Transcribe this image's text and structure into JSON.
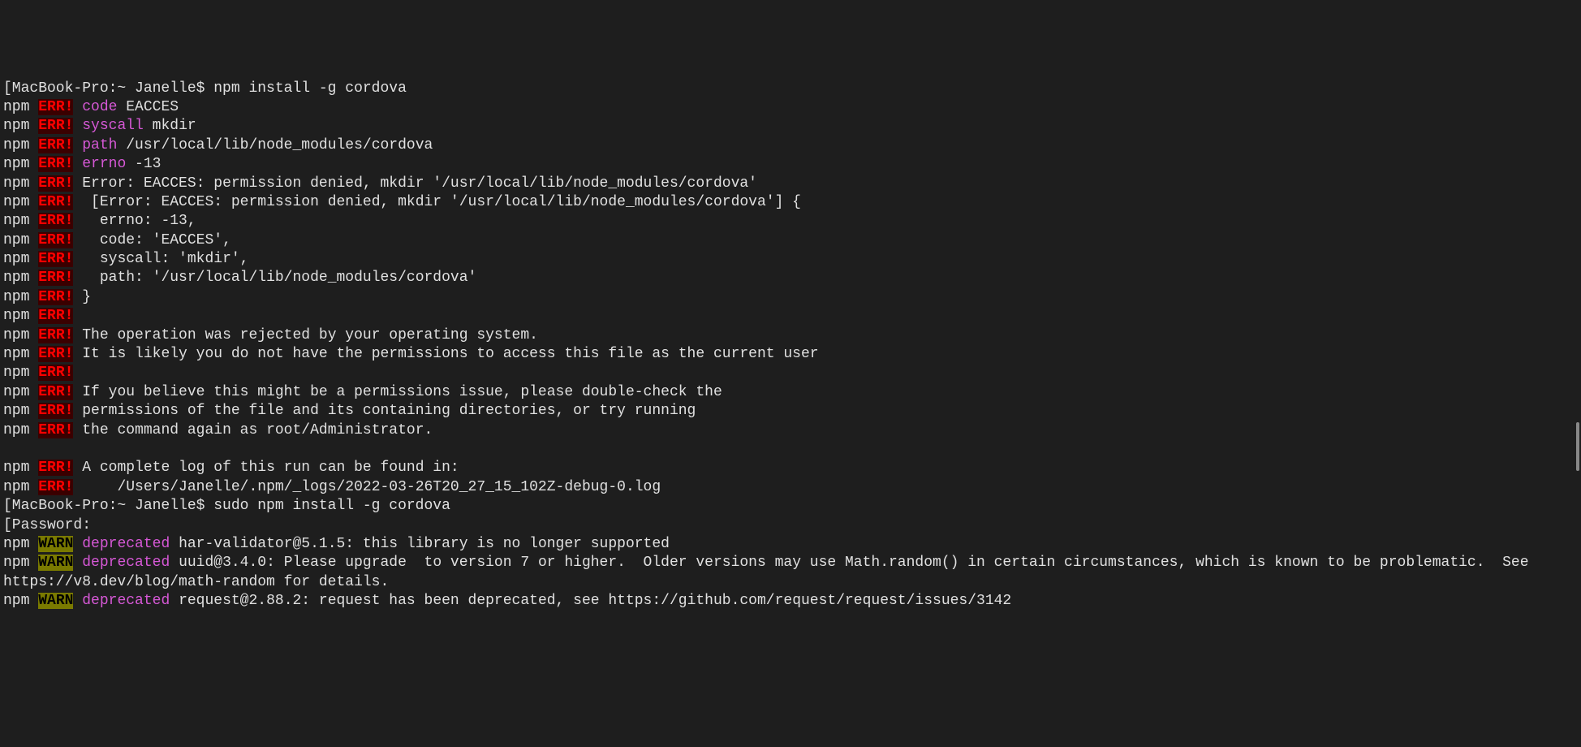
{
  "lines": [
    {
      "type": "prompt",
      "text": "[MacBook-Pro:~ Janelle$ npm install -g cordova"
    },
    {
      "type": "err",
      "prefix": "npm ",
      "tag": "ERR!",
      "key": " code",
      "msg": " EACCES"
    },
    {
      "type": "err",
      "prefix": "npm ",
      "tag": "ERR!",
      "key": " syscall",
      "msg": " mkdir"
    },
    {
      "type": "err",
      "prefix": "npm ",
      "tag": "ERR!",
      "key": " path",
      "msg": " /usr/local/lib/node_modules/cordova"
    },
    {
      "type": "err",
      "prefix": "npm ",
      "tag": "ERR!",
      "key": " errno",
      "msg": " -13"
    },
    {
      "type": "err",
      "prefix": "npm ",
      "tag": "ERR!",
      "msg": " Error: EACCES: permission denied, mkdir '/usr/local/lib/node_modules/cordova'"
    },
    {
      "type": "err",
      "prefix": "npm ",
      "tag": "ERR!",
      "msg": "  [Error: EACCES: permission denied, mkdir '/usr/local/lib/node_modules/cordova'] {"
    },
    {
      "type": "err",
      "prefix": "npm ",
      "tag": "ERR!",
      "msg": "   errno: -13,"
    },
    {
      "type": "err",
      "prefix": "npm ",
      "tag": "ERR!",
      "msg": "   code: 'EACCES',"
    },
    {
      "type": "err",
      "prefix": "npm ",
      "tag": "ERR!",
      "msg": "   syscall: 'mkdir',"
    },
    {
      "type": "err",
      "prefix": "npm ",
      "tag": "ERR!",
      "msg": "   path: '/usr/local/lib/node_modules/cordova'"
    },
    {
      "type": "err",
      "prefix": "npm ",
      "tag": "ERR!",
      "msg": " }"
    },
    {
      "type": "err",
      "prefix": "npm ",
      "tag": "ERR!",
      "msg": ""
    },
    {
      "type": "err",
      "prefix": "npm ",
      "tag": "ERR!",
      "msg": " The operation was rejected by your operating system."
    },
    {
      "type": "err",
      "prefix": "npm ",
      "tag": "ERR!",
      "msg": " It is likely you do not have the permissions to access this file as the current user"
    },
    {
      "type": "err",
      "prefix": "npm ",
      "tag": "ERR!",
      "msg": ""
    },
    {
      "type": "err",
      "prefix": "npm ",
      "tag": "ERR!",
      "msg": " If you believe this might be a permissions issue, please double-check the"
    },
    {
      "type": "err",
      "prefix": "npm ",
      "tag": "ERR!",
      "msg": " permissions of the file and its containing directories, or try running"
    },
    {
      "type": "err",
      "prefix": "npm ",
      "tag": "ERR!",
      "msg": " the command again as root/Administrator."
    },
    {
      "type": "blank",
      "text": ""
    },
    {
      "type": "err",
      "prefix": "npm ",
      "tag": "ERR!",
      "msg": " A complete log of this run can be found in:"
    },
    {
      "type": "err",
      "prefix": "npm ",
      "tag": "ERR!",
      "msg": "     /Users/Janelle/.npm/_logs/2022-03-26T20_27_15_102Z-debug-0.log"
    },
    {
      "type": "prompt",
      "text": "[MacBook-Pro:~ Janelle$ sudo npm install -g cordova"
    },
    {
      "type": "prompt",
      "text": "[Password:"
    },
    {
      "type": "warn",
      "prefix": "npm ",
      "tag": "WARN",
      "key": " deprecated",
      "msg": " har-validator@5.1.5: this library is no longer supported"
    },
    {
      "type": "warn",
      "prefix": "npm ",
      "tag": "WARN",
      "key": " deprecated",
      "msg": " uuid@3.4.0: Please upgrade  to version 7 or higher.  Older versions may use Math.random() in certain circumstances, which is known to be problematic.  See https://v8.dev/blog/math-random for details."
    },
    {
      "type": "warn",
      "prefix": "npm ",
      "tag": "WARN",
      "key": " deprecated",
      "msg": " request@2.88.2: request has been deprecated, see https://github.com/request/request/issues/3142"
    }
  ]
}
